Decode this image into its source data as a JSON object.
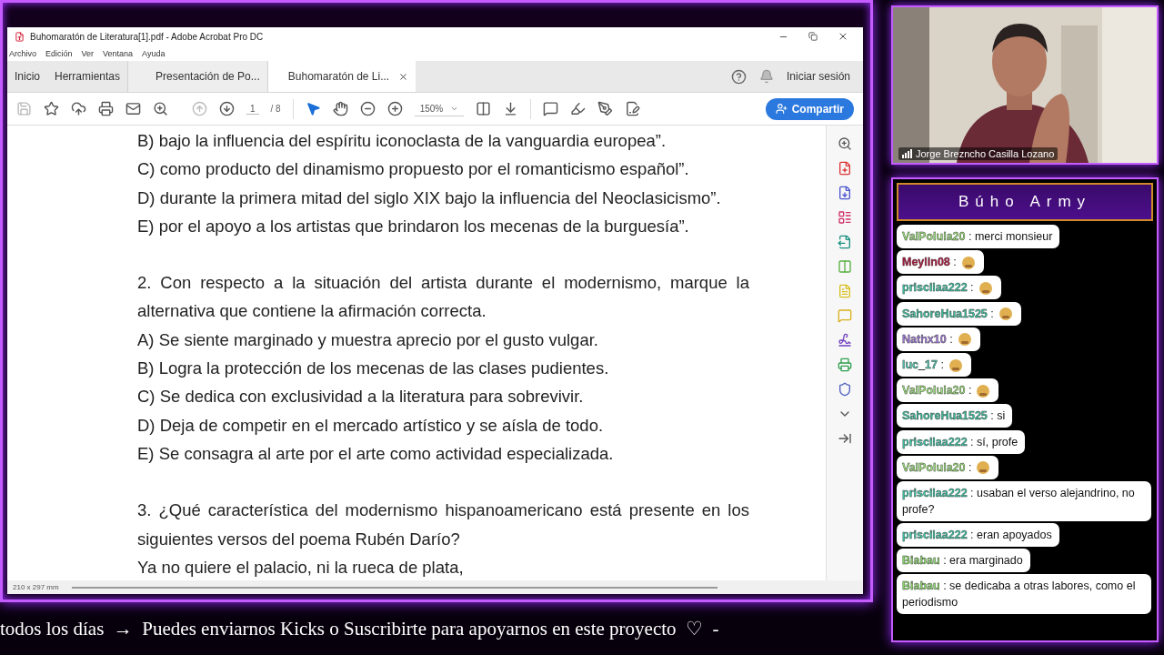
{
  "window": {
    "title": "Buhomaratón de Literatura[1].pdf - Adobe Acrobat Pro DC"
  },
  "menu": [
    "Archivo",
    "Edición",
    "Ver",
    "Ventana",
    "Ayuda"
  ],
  "nav": [
    "Inicio",
    "Herramientas"
  ],
  "tabs": [
    {
      "label": "Presentación de Po...",
      "selected": false
    },
    {
      "label": "Buhomaratón de Li...",
      "selected": true
    }
  ],
  "sign_in": "Iniciar sesión",
  "toolbar": {
    "page": "1",
    "page_count": "/ 8",
    "zoom": "150%",
    "share": "Compartir"
  },
  "document": [
    {
      "kind": "line",
      "text": "B) bajo la influencia del espíritu iconoclasta de la vanguardia europea”."
    },
    {
      "kind": "line",
      "text": "C) como producto del dinamismo propuesto por el romanticismo español”."
    },
    {
      "kind": "line",
      "text": "D) durante la primera mitad del siglo XIX bajo la influencia del Neoclasicismo”."
    },
    {
      "kind": "line",
      "text": "E) por el apoyo a los artistas que brindaron los mecenas de la burguesía”."
    },
    {
      "kind": "space"
    },
    {
      "kind": "full",
      "text": "2. Con respecto a la situación del artista durante el modernismo, marque la"
    },
    {
      "kind": "line",
      "text": "alternativa que contiene la afirmación correcta."
    },
    {
      "kind": "line",
      "text": "A) Se siente marginado y muestra aprecio por el gusto vulgar."
    },
    {
      "kind": "line",
      "text": "B) Logra la protección de los mecenas de las clases pudientes."
    },
    {
      "kind": "line",
      "text": "C) Se dedica con exclusividad a la literatura para sobrevivir."
    },
    {
      "kind": "line",
      "text": "D) Deja de competir en el mercado artístico y se aísla de todo."
    },
    {
      "kind": "line",
      "text": "E) Se consagra al arte por el arte como actividad especializada."
    },
    {
      "kind": "space"
    },
    {
      "kind": "full",
      "text": "3. ¿Qué característica del modernismo hispanoamericano está presente en los"
    },
    {
      "kind": "line",
      "text": "siguientes versos del poema Rubén Darío?"
    },
    {
      "kind": "line",
      "text": "Ya no quiere el palacio, ni la rueca de plata,"
    }
  ],
  "status": "210 x 297 mm",
  "webcam": {
    "name": "Jorge Brezncho Casilla Lozano"
  },
  "chat": {
    "title": "Búho Army",
    "messages": [
      {
        "user": "ValPolula20",
        "color": "#9be07a",
        "kind": "text",
        "text": ": merci monsieur"
      },
      {
        "user": "Meylin08",
        "color": "#b0143c",
        "kind": "emote",
        "text": ":"
      },
      {
        "user": "priscilaa222",
        "color": "#3cc9a8",
        "kind": "emote",
        "text": ":"
      },
      {
        "user": "SahoreHua1525",
        "color": "#3bbf9c",
        "kind": "emote",
        "text": ":"
      },
      {
        "user": "Nathx10",
        "color": "#a07ad8",
        "kind": "emote",
        "text": ":"
      },
      {
        "user": "luc_17",
        "color": "#4fc7b0",
        "kind": "emote",
        "text": ":"
      },
      {
        "user": "ValPolula20",
        "color": "#9be07a",
        "kind": "emote",
        "text": ":"
      },
      {
        "user": "SahoreHua1525",
        "color": "#3bbf9c",
        "kind": "text",
        "text": ": si"
      },
      {
        "user": "priscilaa222",
        "color": "#3cc9a8",
        "kind": "text",
        "text": ": sí, profe"
      },
      {
        "user": "ValPolula20",
        "color": "#9be07a",
        "kind": "emote",
        "text": ":"
      },
      {
        "user": "priscilaa222",
        "color": "#3cc9a8",
        "kind": "text",
        "text": ": usaban el verso alejandrino, no profe?"
      },
      {
        "user": "priscilaa222",
        "color": "#3cc9a8",
        "kind": "text",
        "text": ": eran apoyados"
      },
      {
        "user": "Biabau",
        "color": "#8ad86a",
        "kind": "text",
        "text": ": era marginado"
      },
      {
        "user": "Biabau",
        "color": "#8ad86a",
        "kind": "text",
        "text": ": se dedicaba a otras labores, como el periodismo"
      }
    ]
  },
  "ticker": "todos los días  →  Puedes enviarnos Kicks o Suscribirte para apoyarnos en este proyecto  ♡  -"
}
